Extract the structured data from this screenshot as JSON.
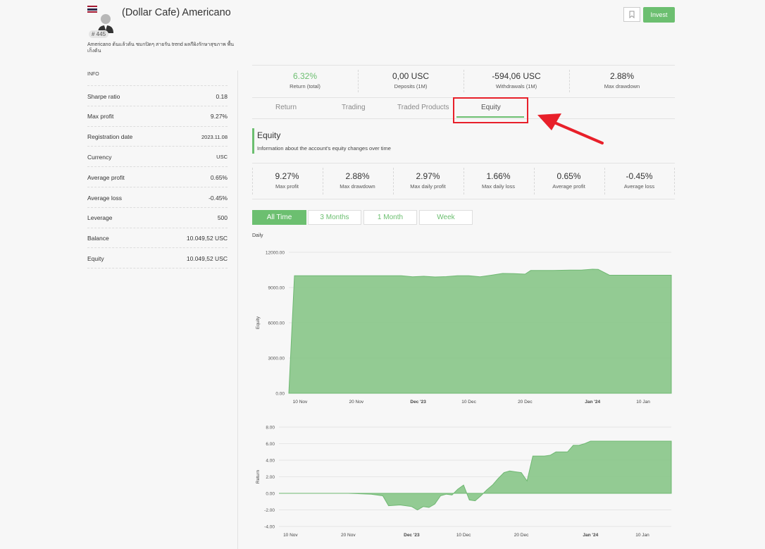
{
  "header": {
    "title": "(Dollar Cafe) Americano",
    "account_id": "# 445",
    "description": "Americano ต้นแล้วต้น ชมกปิดๆ สายรัน trend ผลกีผิงรักษาสุขภาพ พื้นเก็งต้น",
    "invest_label": "Invest"
  },
  "info": {
    "title": "INFO",
    "rows": [
      {
        "label": "Sharpe ratio",
        "value": "0.18"
      },
      {
        "label": "Max profit",
        "value": "9.27%"
      },
      {
        "label": "Registration date",
        "value": "2023.11.08"
      },
      {
        "label": "Currency",
        "value": "USC"
      },
      {
        "label": "Average profit",
        "value": "0.65%"
      },
      {
        "label": "Average loss",
        "value": "-0.45%"
      },
      {
        "label": "Leverage",
        "value": "500"
      },
      {
        "label": "Balance",
        "value": "10.049,52 USC"
      },
      {
        "label": "Equity",
        "value": "10.049,52 USC"
      }
    ]
  },
  "summary": [
    {
      "value": "6.32%",
      "label": "Return (total)"
    },
    {
      "value": "0,00 USC",
      "label": "Deposits (1M)"
    },
    {
      "value": "-594,06 USC",
      "label": "Withdrawals (1M)"
    },
    {
      "value": "2.88%",
      "label": "Max drawdown"
    }
  ],
  "tabs": [
    {
      "label": "Return"
    },
    {
      "label": "Trading"
    },
    {
      "label": "Traded Products"
    },
    {
      "label": "Equity"
    }
  ],
  "equity_section": {
    "title": "Equity",
    "subtitle": "Information about the account's equity changes over time"
  },
  "metrics": [
    {
      "value": "9.27%",
      "label": "Max profit"
    },
    {
      "value": "2.88%",
      "label": "Max drawdown"
    },
    {
      "value": "2.97%",
      "label": "Max daily profit"
    },
    {
      "value": "1.66%",
      "label": "Max daily loss"
    },
    {
      "value": "0.65%",
      "label": "Average profit"
    },
    {
      "value": "-0.45%",
      "label": "Average loss"
    }
  ],
  "ranges": [
    {
      "label": "All Time"
    },
    {
      "label": "3 Months"
    },
    {
      "label": "1 Month"
    },
    {
      "label": "Week"
    }
  ],
  "period_label": "Daily",
  "colors": {
    "accent": "#6cbf70",
    "area": "#8dc88d",
    "annotation": "#e8202a"
  },
  "chart_data": [
    {
      "type": "area",
      "ylabel": "Equity",
      "ylim": [
        0,
        12000
      ],
      "yticks": [
        "12000.00",
        "9000.00",
        "6000.00",
        "3000.00",
        "0.00"
      ],
      "xticks": [
        "10 Nov",
        "20 Nov",
        "Dec '23",
        "10 Dec",
        "20 Dec",
        "Jan '24",
        "10 Jan"
      ],
      "x": [
        "2023-11-08",
        "2023-11-09",
        "2023-11-10",
        "2023-11-13",
        "2023-11-16",
        "2023-11-20",
        "2023-11-24",
        "2023-11-28",
        "2023-11-30",
        "2023-12-02",
        "2023-12-04",
        "2023-12-06",
        "2023-12-08",
        "2023-12-10",
        "2023-12-12",
        "2023-12-14",
        "2023-12-16",
        "2023-12-18",
        "2023-12-20",
        "2023-12-21",
        "2023-12-25",
        "2023-12-28",
        "2023-12-30",
        "2024-01-01",
        "2024-01-02",
        "2024-01-04",
        "2024-01-07",
        "2024-01-10",
        "2024-01-15"
      ],
      "values": [
        0,
        10000,
        10000,
        10000,
        10000,
        10000,
        10000,
        10000,
        9920,
        9960,
        9900,
        9930,
        10010,
        10000,
        9920,
        10050,
        10200,
        10180,
        10140,
        10450,
        10450,
        10480,
        10490,
        10560,
        10550,
        10050,
        10050,
        10050,
        10050
      ]
    },
    {
      "type": "area",
      "ylabel": "Return",
      "ylim": [
        -4,
        8
      ],
      "yticks": [
        "8.00",
        "6.00",
        "4.00",
        "2.00",
        "0.00",
        "-2.00",
        "-4.00"
      ],
      "xticks": [
        "10 Nov",
        "20 Nov",
        "Dec '23",
        "10 Dec",
        "20 Dec",
        "Jan '24",
        "10 Jan"
      ],
      "x": [
        "2023-11-08",
        "2023-11-20",
        "2023-11-24",
        "2023-11-26",
        "2023-11-27",
        "2023-11-29",
        "2023-12-01",
        "2023-12-02",
        "2023-12-03",
        "2023-12-04",
        "2023-12-05",
        "2023-12-06",
        "2023-12-07",
        "2023-12-08",
        "2023-12-09",
        "2023-12-10",
        "2023-12-11",
        "2023-12-12",
        "2023-12-13",
        "2023-12-14",
        "2023-12-15",
        "2023-12-16",
        "2023-12-17",
        "2023-12-18",
        "2023-12-19",
        "2023-12-20",
        "2023-12-21",
        "2023-12-22",
        "2023-12-24",
        "2023-12-25",
        "2023-12-26",
        "2023-12-27",
        "2023-12-28",
        "2023-12-29",
        "2023-12-30",
        "2023-12-31",
        "2024-01-01",
        "2024-01-02",
        "2024-01-04",
        "2024-01-08",
        "2024-01-15"
      ],
      "values": [
        0,
        0,
        -0.1,
        -0.3,
        -1.5,
        -1.4,
        -1.6,
        -2.0,
        -1.6,
        -1.7,
        -1.3,
        -0.3,
        -0.1,
        -0.2,
        0.5,
        1.0,
        -0.8,
        -0.9,
        -0.3,
        0.4,
        1.0,
        1.8,
        2.5,
        2.7,
        2.6,
        2.5,
        1.5,
        4.5,
        4.5,
        4.6,
        5.0,
        5.0,
        5.0,
        5.8,
        5.8,
        6.0,
        6.3,
        6.3,
        6.3,
        6.3,
        6.3
      ]
    }
  ]
}
